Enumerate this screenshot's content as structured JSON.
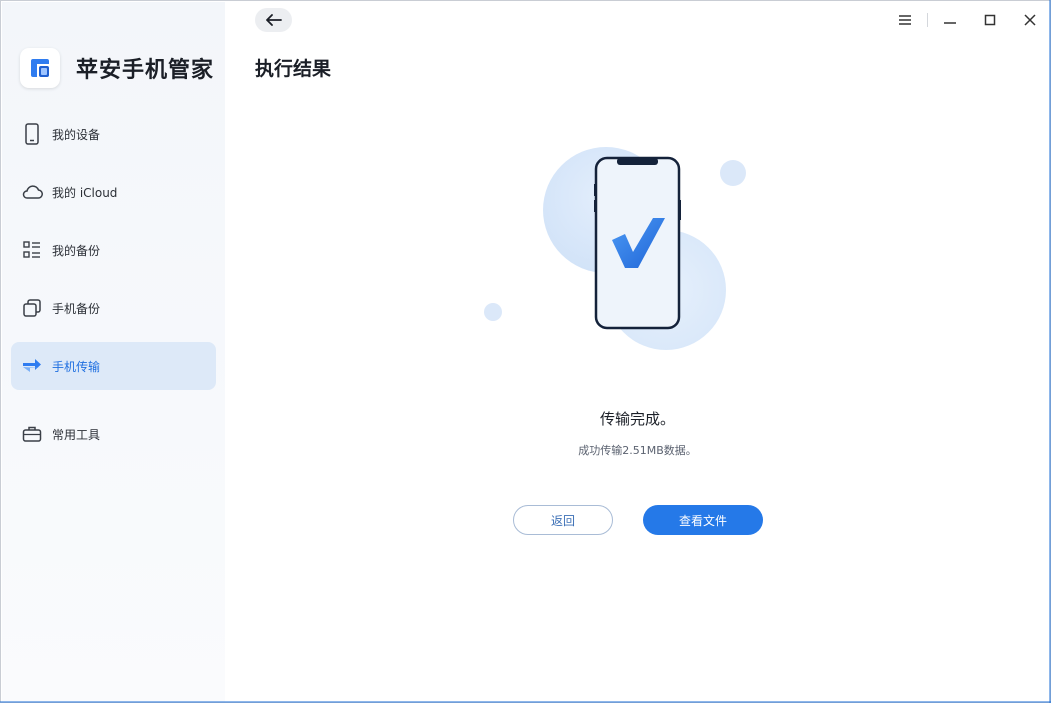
{
  "app": {
    "name": "苹安手机管家"
  },
  "sidebar": {
    "items": [
      {
        "label": "我的设备",
        "icon": "phone-icon"
      },
      {
        "label": "我的 iCloud",
        "icon": "cloud-icon"
      },
      {
        "label": "我的备份",
        "icon": "list-icon"
      },
      {
        "label": "手机备份",
        "icon": "copy-icon"
      },
      {
        "label": "手机传输",
        "icon": "transfer-icon",
        "active": true
      },
      {
        "label": "常用工具",
        "icon": "toolbox-icon"
      }
    ]
  },
  "header": {
    "title": "执行结果"
  },
  "result": {
    "title": "传输完成。",
    "subtitle": "成功传输2.51MB数据。"
  },
  "actions": {
    "back_label": "返回",
    "view_label": "查看文件"
  },
  "colors": {
    "accent": "#2579e8",
    "active_bg": "#dde9f8",
    "sidebar_bg": "#f4f7fb"
  }
}
